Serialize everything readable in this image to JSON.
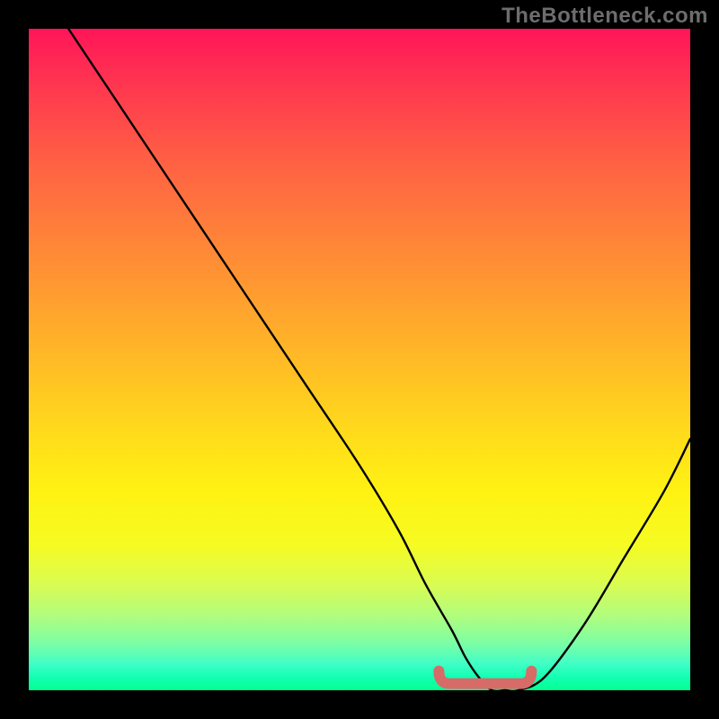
{
  "watermark": "TheBottleneck.com",
  "chart_data": {
    "type": "line",
    "title": "",
    "xlabel": "",
    "ylabel": "",
    "xlim": [
      0,
      100
    ],
    "ylim": [
      0,
      100
    ],
    "grid": false,
    "legend": false,
    "series": [
      {
        "name": "bottleneck-curve",
        "color": "#000000",
        "x": [
          6,
          10,
          18,
          26,
          34,
          42,
          50,
          56,
          60,
          64,
          66,
          68,
          70,
          72,
          74,
          78,
          84,
          90,
          96,
          100
        ],
        "values": [
          100,
          94,
          82,
          70,
          58,
          46,
          34,
          24,
          16,
          9,
          5,
          2,
          0,
          0,
          0,
          2,
          10,
          20,
          30,
          38
        ]
      }
    ],
    "annotations": [
      {
        "name": "optimal-range-marker",
        "color": "#d66b67",
        "x_start": 62,
        "x_end": 76,
        "y": 1
      }
    ]
  }
}
